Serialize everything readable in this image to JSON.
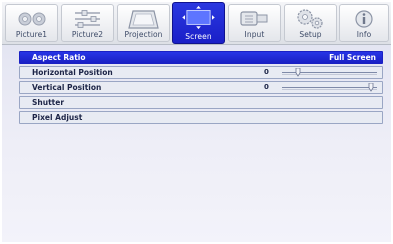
{
  "tabs": [
    {
      "label": "Picture1",
      "icon": "picture1-icon",
      "active": false
    },
    {
      "label": "Picture2",
      "icon": "picture2-icon",
      "active": false
    },
    {
      "label": "Projection",
      "icon": "projection-icon",
      "active": false
    },
    {
      "label": "Screen",
      "icon": "screen-icon",
      "active": true
    },
    {
      "label": "Input",
      "icon": "input-icon",
      "active": false
    },
    {
      "label": "Setup",
      "icon": "setup-icon",
      "active": false
    },
    {
      "label": "Info",
      "icon": "info-icon",
      "active": false
    }
  ],
  "menu": {
    "aspect_ratio": {
      "label": "Aspect Ratio",
      "value": "Full Screen"
    },
    "horizontal_position": {
      "label": "Horizontal Position",
      "value": "0",
      "level": 0.15
    },
    "vertical_position": {
      "label": "Vertical Position",
      "value": "0",
      "level": 0.97
    },
    "shutter": {
      "label": "Shutter"
    },
    "pixel_adjust": {
      "label": "Pixel Adjust"
    }
  },
  "colors": {
    "accent": "#1f2bd6",
    "text": "#1d2547"
  }
}
